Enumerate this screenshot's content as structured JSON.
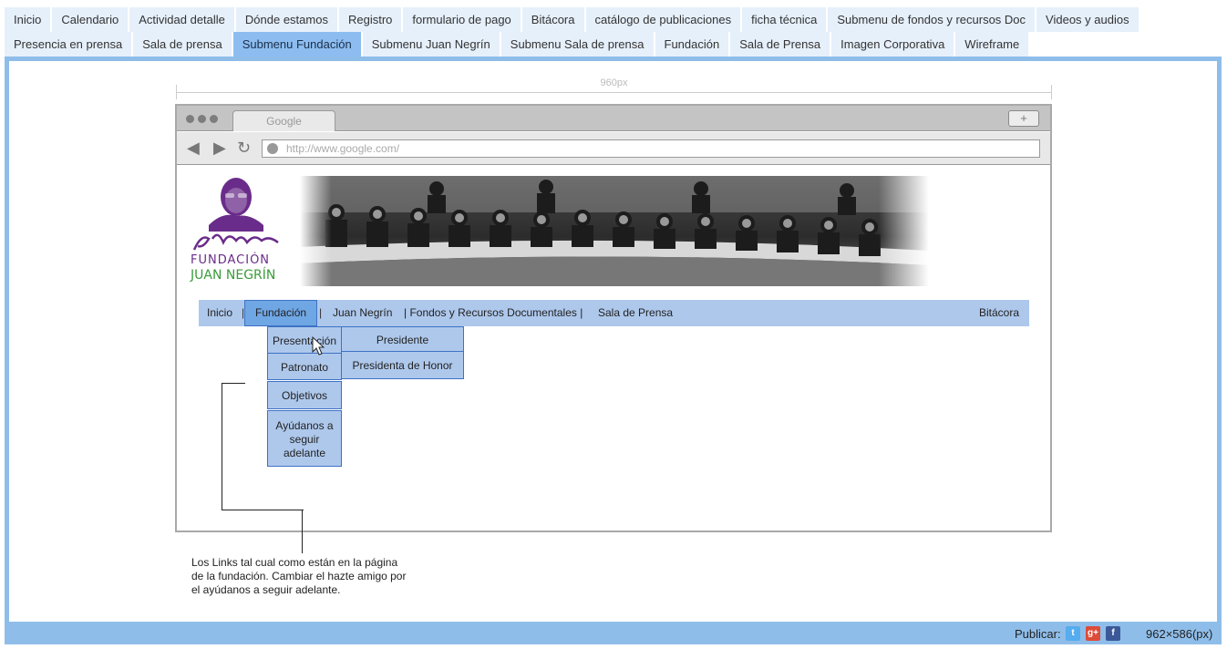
{
  "tabs_row1": [
    "Inicio",
    "Calendario",
    "Actividad detalle",
    "Dónde estamos",
    "Registro",
    "formulario de pago",
    "Bitácora",
    "catálogo de publicaciones",
    "ficha técnica",
    "Submenu de fondos y recursos Doc",
    "Videos y audios"
  ],
  "tabs_row2": [
    "Presencia en prensa",
    "Sala de prensa",
    "Submenu Fundación",
    "Submenu Juan Negrín",
    "Submenu Sala de prensa",
    "Fundación",
    "Sala de Prensa",
    "Imagen Corporativa",
    "Wireframe"
  ],
  "active_tab": "Submenu Fundación",
  "ruler_label": "960px",
  "browser": {
    "tab_title": "Google",
    "new_tab": "+",
    "url": "http://www.google.com/"
  },
  "logo": {
    "line1": "FUNDACIÓN",
    "line2": "JUAN NEGRÍN"
  },
  "menu": {
    "inicio": "Inicio",
    "fundacion": "Fundación",
    "juan_negrin": "Juan Negrín",
    "fondos": "| Fondos y Recursos Documentales |",
    "sala_prensa": "Sala de Prensa",
    "bitacora": "Bitácora",
    "sep": "|"
  },
  "dropdown": [
    "Presentación",
    "Patronato",
    "Objetivos",
    "Ayúdanos a seguir adelante"
  ],
  "submenu": [
    "Presidente",
    "Presidenta de Honor"
  ],
  "note": [
    "Los Links tal cual como están en la página",
    "de la fundación. Cambiar el hazte amigo por",
    "el ayúdanos a seguir adelante."
  ],
  "footer": {
    "publicar": "Publicar:",
    "twitter_icon": "twitter-icon",
    "gplus_icon": "google-plus-icon",
    "facebook_icon": "facebook-icon",
    "dimensions": "962×586(px)"
  },
  "colors": {
    "frame": "#8fbde9",
    "tab": "#e6f0fb",
    "tab_active": "#8dbdf0",
    "menu": "#aec8ec",
    "menu_highlight": "#6fa6e4",
    "logo_purple": "#6a2c8a",
    "logo_green": "#3a9b3a"
  }
}
